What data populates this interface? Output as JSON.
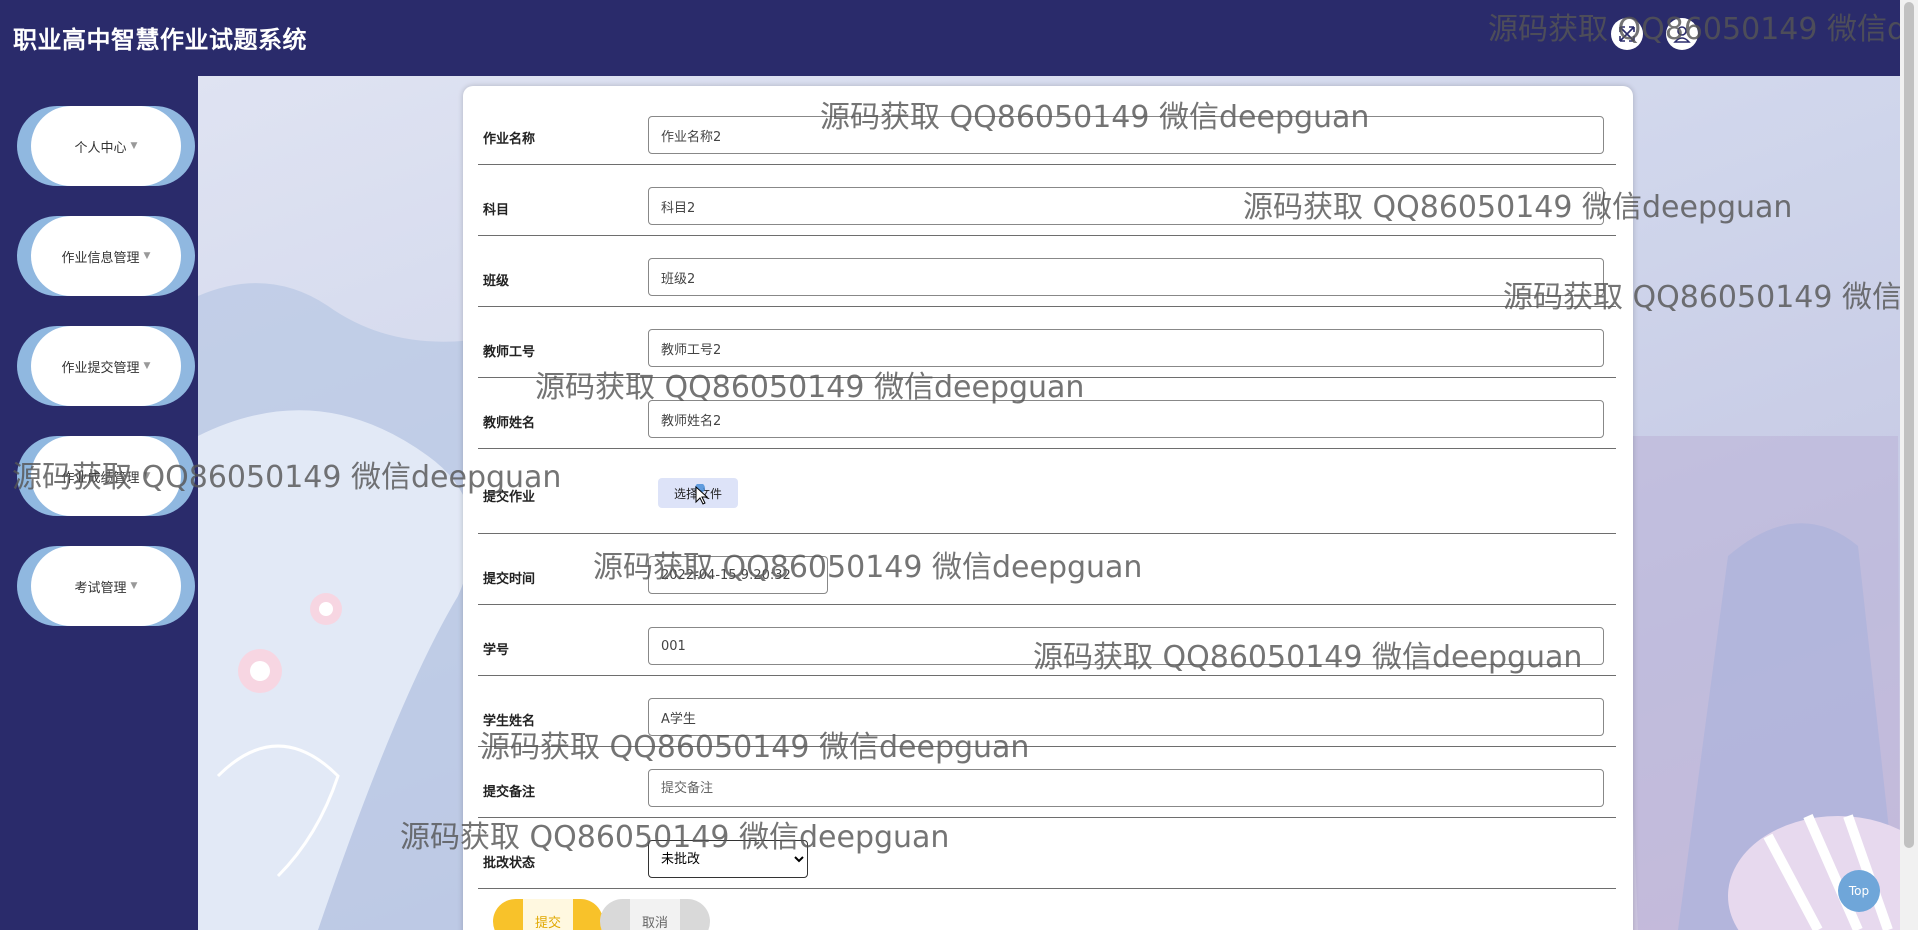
{
  "header": {
    "title": "职业高中智慧作业试题系统"
  },
  "sidebar": {
    "items": [
      {
        "label": "个人中心"
      },
      {
        "label": "作业信息管理"
      },
      {
        "label": "作业提交管理"
      },
      {
        "label": "作业成绩管理"
      },
      {
        "label": "考试管理"
      }
    ]
  },
  "form": {
    "fields": [
      {
        "label": "作业名称",
        "value": "作业名称2"
      },
      {
        "label": "科目",
        "value": "科目2"
      },
      {
        "label": "班级",
        "value": "班级2"
      },
      {
        "label": "教师工号",
        "value": "教师工号2"
      },
      {
        "label": "教师姓名",
        "value": "教师姓名2"
      }
    ],
    "file": {
      "label": "提交作业",
      "button": "选择文件"
    },
    "time": {
      "label": "提交时间",
      "value": "2022-04-15 9:20:32"
    },
    "student_no": {
      "label": "学号",
      "value": "001"
    },
    "student_name": {
      "label": "学生姓名",
      "value": "A学生"
    },
    "remark": {
      "label": "提交备注",
      "placeholder": "提交备注"
    },
    "status": {
      "label": "批改状态",
      "selected": "未批改"
    },
    "submit_label": "提交",
    "cancel_label": "取消"
  },
  "top_button_label": "Top",
  "watermark_text": "源码获取 QQ86050149 微信deepguan",
  "colors": {
    "header_bg": "#2a2b6b",
    "sidebar_blob": "#90b8e0",
    "submit": "#f8c22a",
    "cancel": "#d9d9d9",
    "top_button": "#6fa6d9"
  }
}
